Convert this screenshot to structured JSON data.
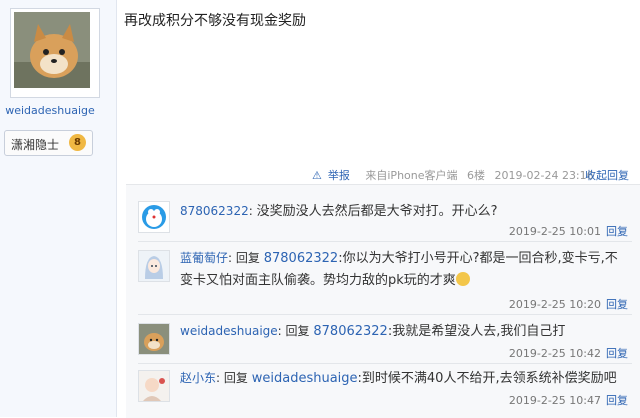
{
  "author": {
    "username": "weidadeshuaige",
    "badge_title": "潇湘隐士",
    "badge_level": "8"
  },
  "post": {
    "content": "再改成积分不够没有现金奖励",
    "report_label": "举报",
    "source": "来自iPhone客户端",
    "floor": "6楼",
    "timestamp": "2019-02-24 23:16",
    "toggle_replies": "收起回复"
  },
  "replies": [
    {
      "user": "878062322",
      "reply_prefix": "",
      "target": "",
      "text": "没奖励没人去然后都是大爷对打。开心么?",
      "text2": "",
      "time": "2019-2-25 10:01",
      "reply_label": "回复"
    },
    {
      "user": "蓝葡萄仔",
      "reply_prefix": "回复",
      "target": "878062322",
      "text": ":你以为大爷打小号开心?都是一回合秒,变卡亏,不",
      "text2": "变卡又怕对面主队偷袭。势均力敌的pk玩的才爽",
      "time": "2019-2-25 10:20",
      "reply_label": "回复"
    },
    {
      "user": "weidadeshuaige",
      "reply_prefix": "回复",
      "target": "878062322",
      "text": ":我就是希望没人去,我们自己打",
      "text2": "",
      "time": "2019-2-25 10:42",
      "reply_label": "回复"
    },
    {
      "user": "赵小东",
      "reply_prefix": "回复",
      "target": "weidadeshuaige",
      "text": ":到时候不满40人不给开,去领系统补偿奖励吧",
      "text2": "",
      "time": "2019-2-25 10:47",
      "reply_label": "回复"
    }
  ]
}
